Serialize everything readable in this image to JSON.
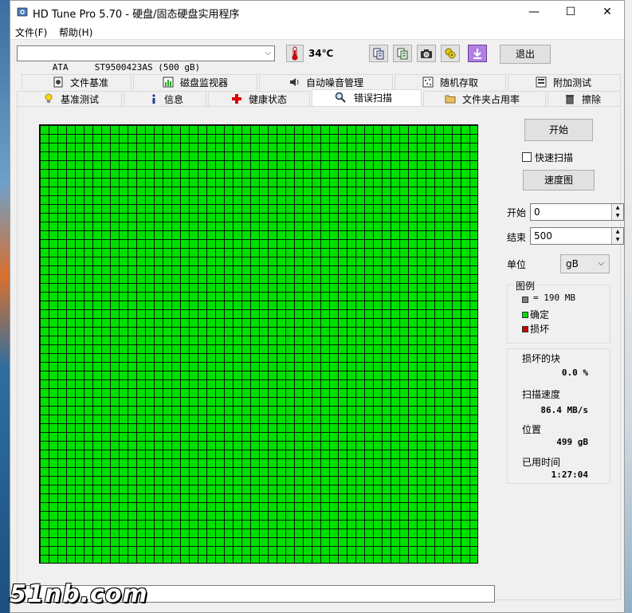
{
  "window": {
    "title": "HD Tune Pro 5.70 - 硬盘/固态硬盘实用程序",
    "min_glyph": "—",
    "max_glyph": "☐",
    "close_glyph": "✕"
  },
  "menu": [
    "文件(F)",
    "帮助(H)"
  ],
  "toolbar": {
    "drive": "ATA     ST9500423AS (500 gB)",
    "temperature": "34℃",
    "exit_label": "退出",
    "icons": [
      "copy-info-icon",
      "copy-text-icon",
      "camera-icon",
      "options-icon",
      "save-icon"
    ]
  },
  "tabs_top": [
    "文件基准",
    "磁盘监视器",
    "自动噪音管理",
    "随机存取",
    "附加测试"
  ],
  "tabs_bottom": [
    "基准测试",
    "信息",
    "健康状态",
    "错误扫描",
    "文件夹占用率",
    "擦除"
  ],
  "active_tab": "错误扫描",
  "scan": {
    "start_button": "开始",
    "quick_scan_label": "快速扫描",
    "quick_scan_checked": false,
    "speed_map_button": "速度图",
    "start_label": "开始",
    "start_value": "0",
    "end_label": "结束",
    "end_value": "500",
    "unit_label": "单位",
    "unit_value": "gB",
    "grid_block_state": "all-ok"
  },
  "legend": {
    "title": "图例",
    "block_size": "= 190 MB",
    "ok_label": "确定",
    "damaged_label": "损坏",
    "ok_color": "#00e000",
    "damaged_color": "#cc0000",
    "block_color": "#808080"
  },
  "stats": {
    "damaged_blocks_label": "损坏的块",
    "damaged_blocks_value": "0.0 %",
    "scan_speed_label": "扫描速度",
    "scan_speed_value": "86.4 MB/s",
    "position_label": "位置",
    "position_value": "499 gB",
    "elapsed_label": "已用时间",
    "elapsed_value": "1:27:04"
  },
  "watermark": "51nb.com"
}
